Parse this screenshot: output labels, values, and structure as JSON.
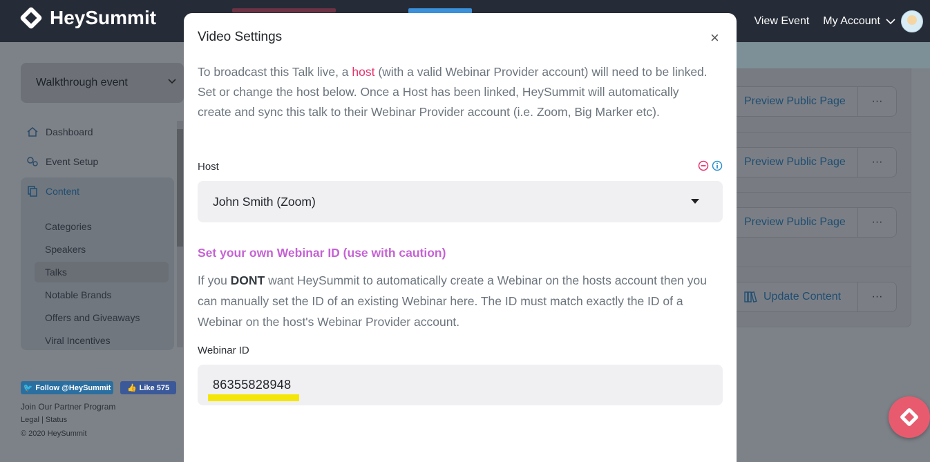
{
  "app": {
    "logo_text": "HeySummit"
  },
  "header": {
    "view_event": "View Event",
    "my_account": "My Account"
  },
  "sidebar": {
    "event_select": "Walkthrough event",
    "nav": [
      {
        "label": "Dashboard",
        "icon": "home-icon"
      },
      {
        "label": "Event Setup",
        "icon": "gears-icon"
      },
      {
        "label": "Content",
        "icon": "copy-icon"
      }
    ],
    "sub_nav": [
      "Categories",
      "Speakers",
      "Talks",
      "Notable Brands",
      "Offers and Giveaways",
      "Viral Incentives"
    ],
    "active_sub": "Talks",
    "social": {
      "twitter": "Follow @HeySummit",
      "facebook": "Like 575"
    },
    "footer": {
      "partner": "Join Our Partner Program",
      "legal": "Legal",
      "status": "Status",
      "copyright": "© 2020 HeySummit"
    }
  },
  "right_panel": {
    "rows": [
      {
        "label": "Preview Public Page",
        "more": "···"
      },
      {
        "label": "Preview Public Page",
        "more": "···"
      },
      {
        "label": "Preview Public Page",
        "more": "···"
      },
      {
        "label": "Update Content",
        "more": "···",
        "icon": "books-icon"
      }
    ]
  },
  "modal": {
    "title": "Video Settings",
    "close": "×",
    "intro_before": "To broadcast this Talk live, a ",
    "intro_host": "host",
    "intro_after": " (with a valid Webinar Provider account) will need to be linked. Set or change the host below. Once a Host has been linked, HeySummit will automatically create and sync this talk to their Webinar Provider account (i.e. Zoom, Big Marker etc).",
    "host_label": "Host",
    "host_value": "John Smith (Zoom)",
    "own_id_link": "Set your own Webinar ID (use with caution)",
    "desc_before": "If you ",
    "desc_bold": "DONT",
    "desc_after": " want HeySummit to automatically create a Webinar on the hosts account then you can manually set the ID of an existing Webinar here. The ID must match exactly the ID of a Webinar on the host's Webinar Provider account.",
    "webinar_label": "Webinar ID",
    "webinar_value": "86355828948"
  },
  "colors": {
    "accent": "#e5326b",
    "link": "#c562d4",
    "highlight": "#f5e60a",
    "topbar": "#262c37"
  }
}
